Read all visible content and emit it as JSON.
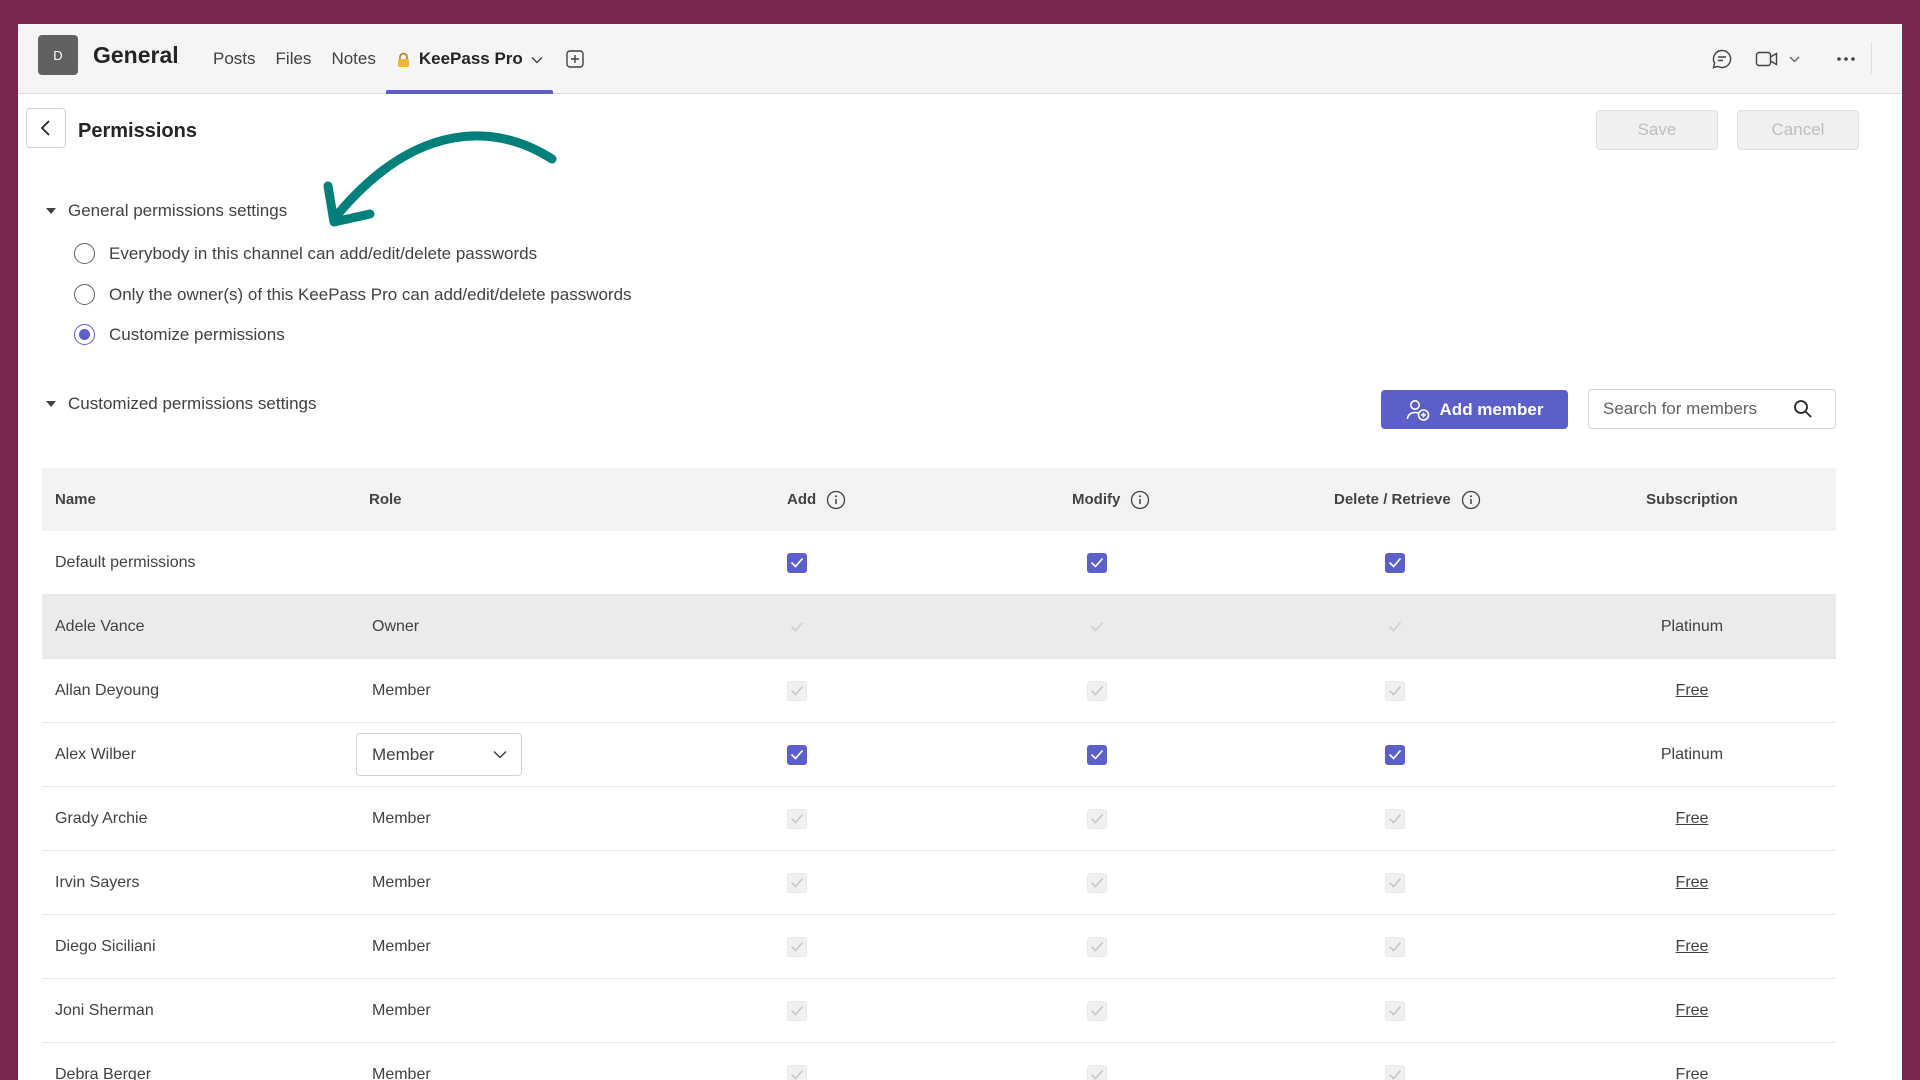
{
  "topbar": {
    "team_initial": "D",
    "channel": "General",
    "tabs": [
      {
        "label": "Posts"
      },
      {
        "label": "Files"
      },
      {
        "label": "Notes"
      },
      {
        "label": "KeePass Pro"
      }
    ],
    "icons": [
      "chat-icon",
      "video-icon",
      "chevron-down-icon",
      "more-icon"
    ]
  },
  "header": {
    "title": "Permissions",
    "save_label": "Save",
    "cancel_label": "Cancel"
  },
  "general": {
    "heading": "General permissions settings",
    "options": [
      {
        "label": "Everybody in this channel can add/edit/delete passwords",
        "checked": false
      },
      {
        "label": "Only the owner(s) of this KeePass Pro can add/edit/delete passwords",
        "checked": false
      },
      {
        "label": "Customize permissions",
        "checked": true
      }
    ]
  },
  "custom": {
    "heading": "Customized permissions settings",
    "add_member_label": "Add member",
    "search_placeholder": "Search for members"
  },
  "table": {
    "columns": {
      "name": "Name",
      "role": "Role",
      "add": "Add",
      "modify": "Modify",
      "delete": "Delete / Retrieve",
      "subscription": "Subscription"
    },
    "rows": [
      {
        "name": "Default permissions",
        "role": "",
        "add": "on",
        "modify": "on",
        "delete": "on",
        "subscription": "",
        "sub_link": false
      },
      {
        "name": "Adele Vance",
        "role": "Owner",
        "add": "ghost",
        "modify": "ghost",
        "delete": "ghost",
        "subscription": "Platinum",
        "sub_link": false,
        "highlight": true
      },
      {
        "name": "Allan Deyoung",
        "role": "Member",
        "add": "dis",
        "modify": "dis",
        "delete": "dis",
        "subscription": "Free",
        "sub_link": true
      },
      {
        "name": "Alex Wilber",
        "role": "Member",
        "role_dropdown": true,
        "add": "on",
        "modify": "on",
        "delete": "on",
        "subscription": "Platinum",
        "sub_link": false
      },
      {
        "name": "Grady Archie",
        "role": "Member",
        "add": "dis",
        "modify": "dis",
        "delete": "dis",
        "subscription": "Free",
        "sub_link": true
      },
      {
        "name": "Irvin Sayers",
        "role": "Member",
        "add": "dis",
        "modify": "dis",
        "delete": "dis",
        "subscription": "Free",
        "sub_link": true
      },
      {
        "name": "Diego Siciliani",
        "role": "Member",
        "add": "dis",
        "modify": "dis",
        "delete": "dis",
        "subscription": "Free",
        "sub_link": true
      },
      {
        "name": "Joni Sherman",
        "role": "Member",
        "add": "dis",
        "modify": "dis",
        "delete": "dis",
        "subscription": "Free",
        "sub_link": true
      },
      {
        "name": "Debra Berger",
        "role": "Member",
        "add": "dis",
        "modify": "dis",
        "delete": "dis",
        "subscription": "Free",
        "sub_link": true
      }
    ]
  },
  "colors": {
    "accent": "#5b5fc7",
    "frame": "#7a274f",
    "annotation_arrow": "#00807a"
  }
}
